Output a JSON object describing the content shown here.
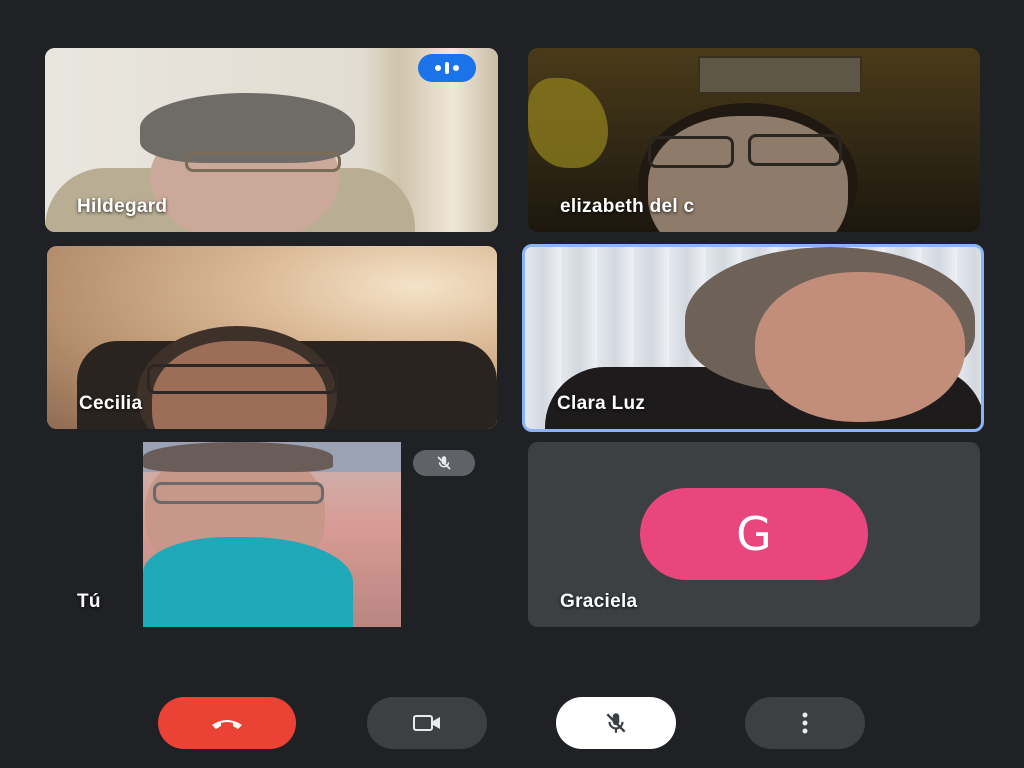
{
  "participants": [
    {
      "name": "Hildegard",
      "speaking": true
    },
    {
      "name": "elizabeth del c"
    },
    {
      "name": "Cecilia"
    },
    {
      "name": "Clara Luz",
      "pinned": true
    },
    {
      "name": "Tú",
      "muted": true
    },
    {
      "name": "Graciela",
      "avatar_initial": "G",
      "avatar_color": "#e8467c"
    }
  ],
  "controls": [
    {
      "icon": "end-call-icon",
      "color": "#ea4335"
    },
    {
      "icon": "camera-icon",
      "color": "#3c4043"
    },
    {
      "icon": "mic-off-icon",
      "color": "#ffffff"
    },
    {
      "icon": "more-options-icon",
      "color": "#3c4043"
    }
  ],
  "colors": {
    "background": "#202124",
    "speaking_badge": "#1a73e8",
    "active_border": "#8ab4f8"
  }
}
